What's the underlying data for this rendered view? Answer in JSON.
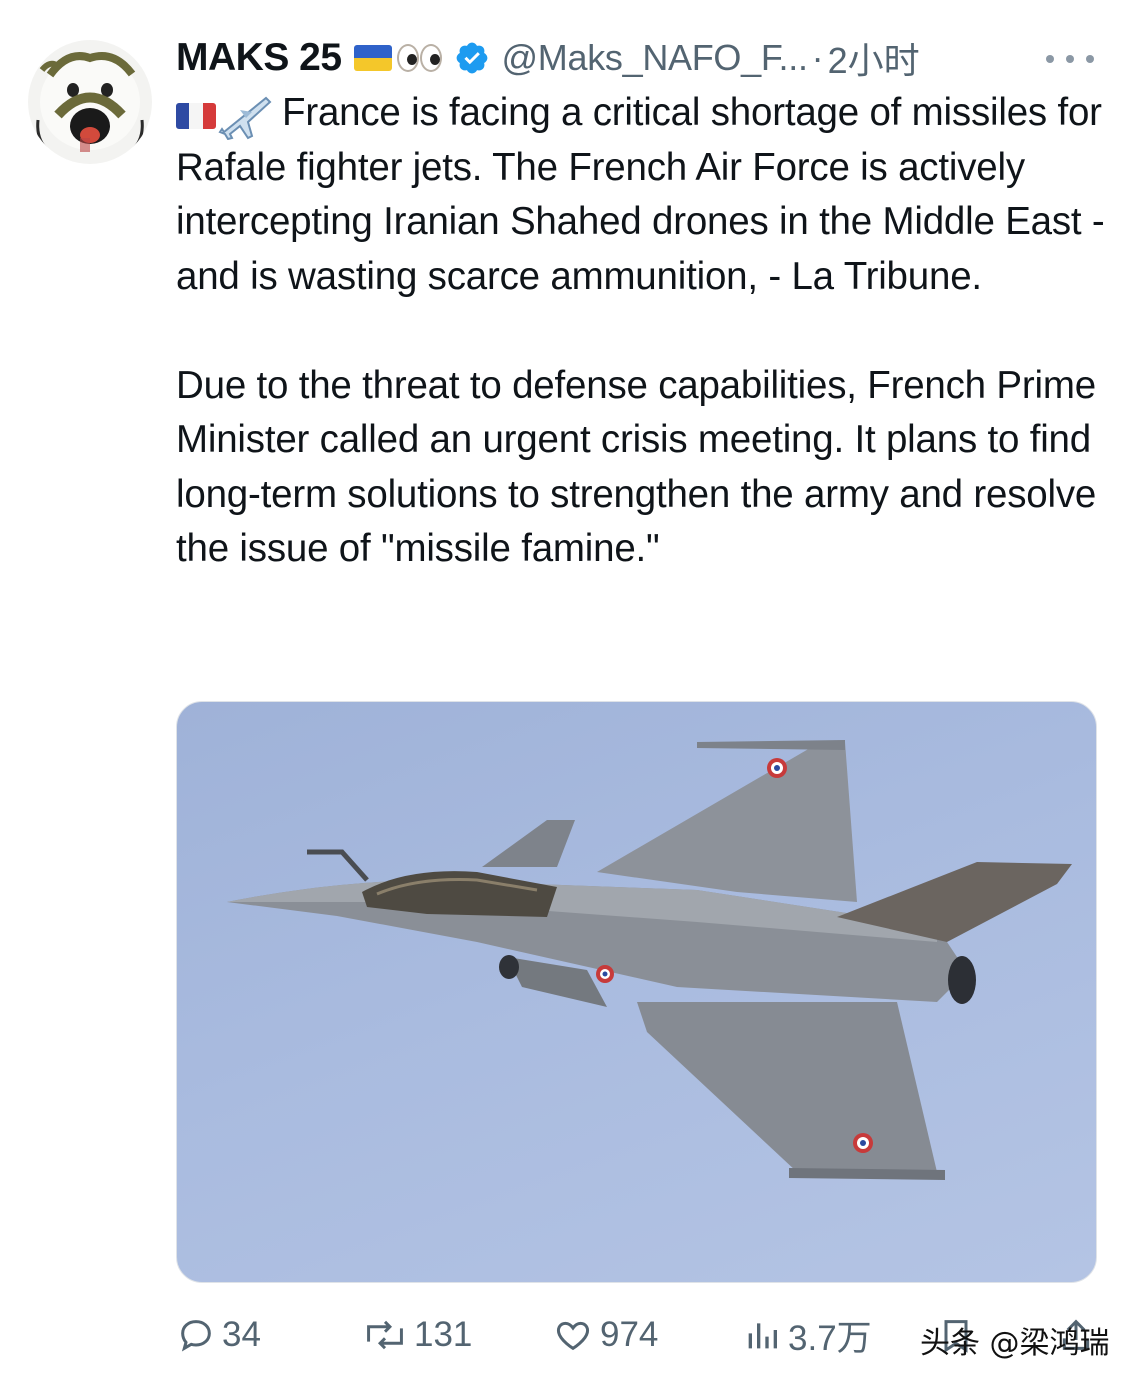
{
  "author": {
    "display_name": "MAKS 25",
    "handle": "@Maks_NAFO_F...",
    "separator": "·",
    "timestamp": "2小时",
    "flag_icon": "ukraine-flag-icon",
    "emoji_icon": "eyes-emoji-icon",
    "verified_icon": "verified-badge-icon",
    "verified_color": "#1d9bf0"
  },
  "tweet": {
    "lead_icons": [
      "france-flag-icon",
      "airplane-emoji-icon"
    ],
    "text": "France is facing a critical shortage of missiles for Rafale fighter jets. The French Air Force is actively intercepting Iranian Shahed drones in the Middle East - and is wasting scarce ammunition, - La Tribune.\n\nDue to the threat to defense capabilities, French Prime Minister called an urgent crisis meeting. It plans to find long-term solutions to strengthen the army and resolve the issue of \"missile famine.\""
  },
  "media": {
    "icon": "rafale-fighter-jet-photo",
    "sky_color": "#a9bbdf"
  },
  "actions": {
    "replies": "34",
    "reposts": "131",
    "likes": "974",
    "views": "3.7万"
  },
  "watermark": "头条 @梁鸿瑞",
  "colors": {
    "text": "#0f1419",
    "secondary": "#536471",
    "accent": "#1d9bf0"
  }
}
